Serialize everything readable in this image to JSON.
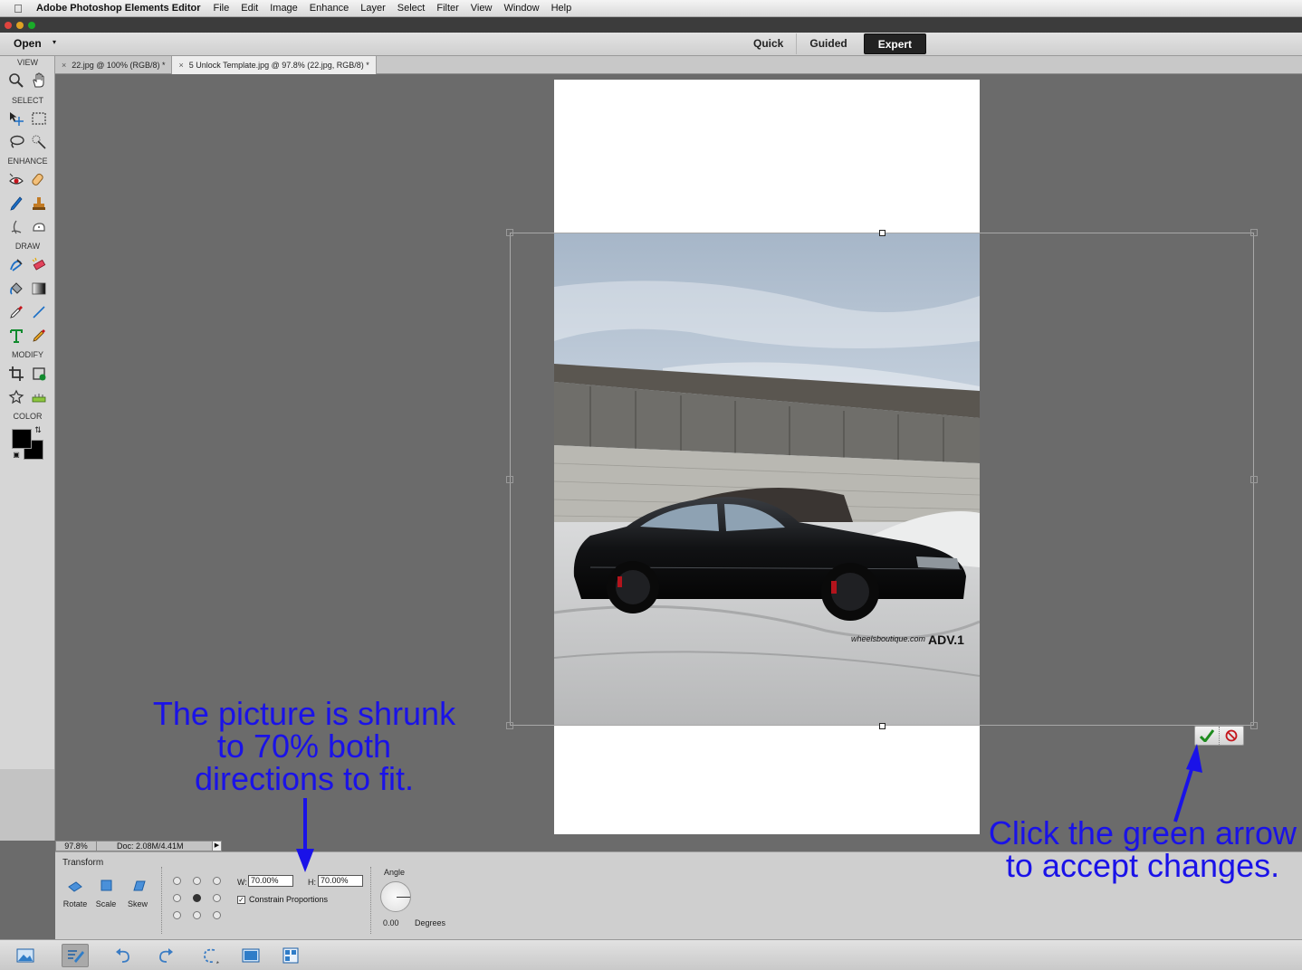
{
  "menubar": {
    "app_name": "Adobe Photoshop Elements Editor",
    "items": [
      "File",
      "Edit",
      "Image",
      "Enhance",
      "Layer",
      "Select",
      "Filter",
      "View",
      "Window",
      "Help"
    ]
  },
  "modebar": {
    "open_label": "Open",
    "modes": [
      {
        "label": "Quick",
        "active": false
      },
      {
        "label": "Guided",
        "active": false
      },
      {
        "label": "Expert",
        "active": true
      }
    ]
  },
  "tools": {
    "sections": {
      "view": "VIEW",
      "select": "SELECT",
      "enhance": "ENHANCE",
      "draw": "DRAW",
      "modify": "MODIFY",
      "color": "COLOR"
    },
    "foreground_color": "#000000",
    "background_color": "#000000"
  },
  "doc_tabs": [
    {
      "label": "22.jpg @ 100% (RGB/8) *",
      "active": false
    },
    {
      "label": "5 Unlock Template.jpg @ 97.8% (22.jpg, RGB/8) *",
      "active": true
    }
  ],
  "statusbar": {
    "zoom": "97.8%",
    "doc": "Doc: 2.08M/4.41M"
  },
  "options": {
    "title": "Transform",
    "buttons": [
      "Rotate",
      "Scale",
      "Skew"
    ],
    "w_label": "W:",
    "w_value": "70.00%",
    "h_label": "H:",
    "h_value": "70.00%",
    "constrain_label": "Constrain Proportions",
    "constrain_checked": true,
    "angle_label": "Angle",
    "angle_value": "0.00",
    "angle_unit": "Degrees"
  },
  "photo": {
    "watermark_left": "wheelsboutique.com",
    "watermark_brand": "ADV.1"
  },
  "annotations": {
    "left_lines": [
      "The picture is shrunk",
      "to 70% both",
      "directions to fit."
    ],
    "right_lines": [
      "Click the green arrow",
      "to accept changes."
    ],
    "color": "#1a12e8"
  }
}
